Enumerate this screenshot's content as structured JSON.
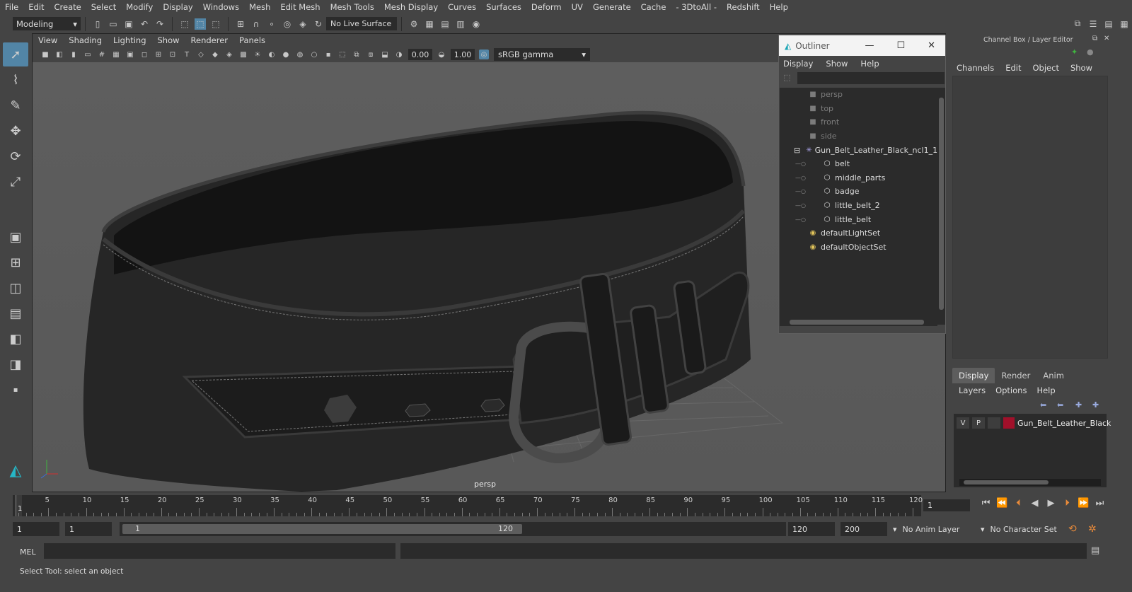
{
  "menu": [
    "File",
    "Edit",
    "Create",
    "Select",
    "Modify",
    "Display",
    "Windows",
    "Mesh",
    "Edit Mesh",
    "Mesh Tools",
    "Mesh Display",
    "Curves",
    "Surfaces",
    "Deform",
    "UV",
    "Generate",
    "Cache",
    "- 3DtoAll -",
    "Redshift",
    "Help"
  ],
  "statusline": {
    "mode": "Modeling",
    "live_surface": "No Live Surface"
  },
  "viewport": {
    "menu": [
      "View",
      "Shading",
      "Lighting",
      "Show",
      "Renderer",
      "Panels"
    ],
    "exposure": "0.00",
    "gamma": "1.00",
    "color_space": "sRGB gamma",
    "camera": "persp"
  },
  "outliner": {
    "title": "Outliner",
    "menu": [
      "Display",
      "Show",
      "Help"
    ],
    "items": [
      {
        "label": "persp",
        "icon": "camera-icon",
        "dim": true,
        "indent": 2
      },
      {
        "label": "top",
        "icon": "camera-icon",
        "dim": true,
        "indent": 2
      },
      {
        "label": "front",
        "icon": "camera-icon",
        "dim": true,
        "indent": 2
      },
      {
        "label": "side",
        "icon": "camera-icon",
        "dim": true,
        "indent": 2
      },
      {
        "label": "Gun_Belt_Leather_Black_ncl1_1",
        "icon": "group-icon",
        "dim": false,
        "indent": 1
      },
      {
        "label": "belt",
        "icon": "mesh-icon",
        "dim": false,
        "indent": 3
      },
      {
        "label": "middle_parts",
        "icon": "mesh-icon",
        "dim": false,
        "indent": 3
      },
      {
        "label": "badge",
        "icon": "mesh-icon",
        "dim": false,
        "indent": 3
      },
      {
        "label": "little_belt_2",
        "icon": "mesh-icon",
        "dim": false,
        "indent": 3
      },
      {
        "label": "little_belt",
        "icon": "mesh-icon",
        "dim": false,
        "indent": 3
      },
      {
        "label": "defaultLightSet",
        "icon": "set-icon",
        "dim": false,
        "indent": 2
      },
      {
        "label": "defaultObjectSet",
        "icon": "set-icon",
        "dim": false,
        "indent": 2
      }
    ]
  },
  "channelbox": {
    "title": "Channel Box / Layer Editor",
    "menu": [
      "Channels",
      "Edit",
      "Object",
      "Show"
    ],
    "tabs": [
      "Display",
      "Render",
      "Anim"
    ],
    "layer_menu": [
      "Layers",
      "Options",
      "Help"
    ],
    "layer": {
      "v": "V",
      "p": "P",
      "name": "Gun_Belt_Leather_Black",
      "color": "#a0102a"
    }
  },
  "timeline": {
    "ticks": [
      "5",
      "10",
      "15",
      "20",
      "25",
      "30",
      "35",
      "40",
      "45",
      "50",
      "55",
      "60",
      "65",
      "70",
      "75",
      "80",
      "85",
      "90",
      "95",
      "100",
      "105",
      "110",
      "115",
      "120"
    ],
    "current_frame": "1",
    "frame_field": "1"
  },
  "range": {
    "start": "1",
    "playback_start": "1",
    "slider_start": "1",
    "slider_end": "120",
    "playback_end": "120",
    "end": "200",
    "anim_layer": "No Anim Layer",
    "char_set": "No Character Set"
  },
  "mel": {
    "label": "MEL"
  },
  "status": "Select Tool: select an object"
}
